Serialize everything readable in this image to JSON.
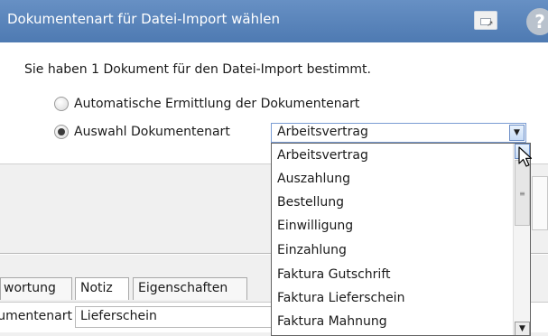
{
  "dialog": {
    "title": "Dokumentenart für Datei-Import wählen",
    "help_glyph": "?",
    "intro": "Sie haben 1 Dokument für den Datei-Import bestimmt.",
    "radio_auto_label": "Automatische Ermittlung der Dokumentenart",
    "radio_select_label": "Auswahl Dokumentenart",
    "selected_radio": "Auswahl Dokumentenart",
    "combo_value": "Arbeitsvertrag"
  },
  "dropdown": {
    "items": [
      "Arbeitsvertrag",
      "Auszahlung",
      "Bestellung",
      "Einwilligung",
      "Einzahlung",
      "Faktura Gutschrift",
      "Faktura Lieferschein",
      "Faktura Mahnung"
    ],
    "scroll_thumb_glyph": "≡",
    "scroll_down_glyph": "▼"
  },
  "background_tabs": {
    "tabs": [
      "wortung",
      "Notiz",
      "Eigenschaften"
    ],
    "field_label": "Dokumentenart",
    "field_value": "Lieferschein"
  },
  "colors": {
    "titlebar": "#5a86bd",
    "accent_border": "#7a9cd3"
  }
}
